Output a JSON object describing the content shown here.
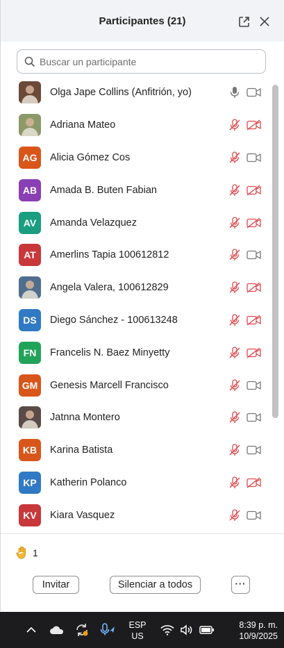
{
  "header": {
    "title": "Participantes (21)"
  },
  "search": {
    "placeholder": "Buscar un participante"
  },
  "colors": {
    "muted": "#e0474c",
    "icon_gray": "#777777"
  },
  "participants": [
    {
      "name": "Olga Jape Collins (Anfitrión, yo)",
      "initials": "",
      "avatar": "photo",
      "color": "#6b4a3a",
      "mic": "on",
      "video": "off"
    },
    {
      "name": "Adriana Mateo",
      "initials": "",
      "avatar": "photo",
      "color": "#8c9a6a",
      "mic": "muted",
      "video": "blocked"
    },
    {
      "name": "Alicia Gómez Cos",
      "initials": "AG",
      "avatar": "initials",
      "color": "#d9561b",
      "mic": "muted",
      "video": "off"
    },
    {
      "name": "Amada B. Buten Fabian",
      "initials": "AB",
      "avatar": "initials",
      "color": "#8b3fb4",
      "mic": "muted",
      "video": "blocked"
    },
    {
      "name": "Amanda Velazquez",
      "initials": "AV",
      "avatar": "initials",
      "color": "#199e80",
      "mic": "muted",
      "video": "blocked"
    },
    {
      "name": "Amerlins Tapia 100612812",
      "initials": "AT",
      "avatar": "initials",
      "color": "#c8373a",
      "mic": "muted",
      "video": "off"
    },
    {
      "name": "Angela Valera, 100612829",
      "initials": "",
      "avatar": "photo",
      "color": "#4f6e8e",
      "mic": "muted",
      "video": "blocked"
    },
    {
      "name": "Diego Sánchez - 100613248",
      "initials": "DS",
      "avatar": "initials",
      "color": "#2f79c5",
      "mic": "muted",
      "video": "blocked"
    },
    {
      "name": "Francelis N. Baez Minyetty",
      "initials": "FN",
      "avatar": "initials",
      "color": "#22a35a",
      "mic": "muted",
      "video": "blocked"
    },
    {
      "name": "Genesis Marcell Francisco",
      "initials": "GM",
      "avatar": "initials",
      "color": "#d9561b",
      "mic": "muted",
      "video": "off"
    },
    {
      "name": "Jatnna Montero",
      "initials": "",
      "avatar": "photo",
      "color": "#5a4a48",
      "mic": "muted",
      "video": "off"
    },
    {
      "name": "Karina Batista",
      "initials": "KB",
      "avatar": "initials",
      "color": "#d9561b",
      "mic": "muted",
      "video": "off"
    },
    {
      "name": "Katherin Polanco",
      "initials": "KP",
      "avatar": "initials",
      "color": "#2f79c5",
      "mic": "muted",
      "video": "blocked"
    },
    {
      "name": "Kiara Vasquez",
      "initials": "KV",
      "avatar": "initials",
      "color": "#c8373a",
      "mic": "muted",
      "video": "off"
    }
  ],
  "raised_hands": {
    "count": "1"
  },
  "footer": {
    "invite_label": "Invitar",
    "mute_all_label": "Silenciar a todos",
    "more_label": "···"
  },
  "taskbar": {
    "language_line1": "ESP",
    "language_line2": "US",
    "time": "8:39 p. m.",
    "date": "10/9/2025"
  }
}
